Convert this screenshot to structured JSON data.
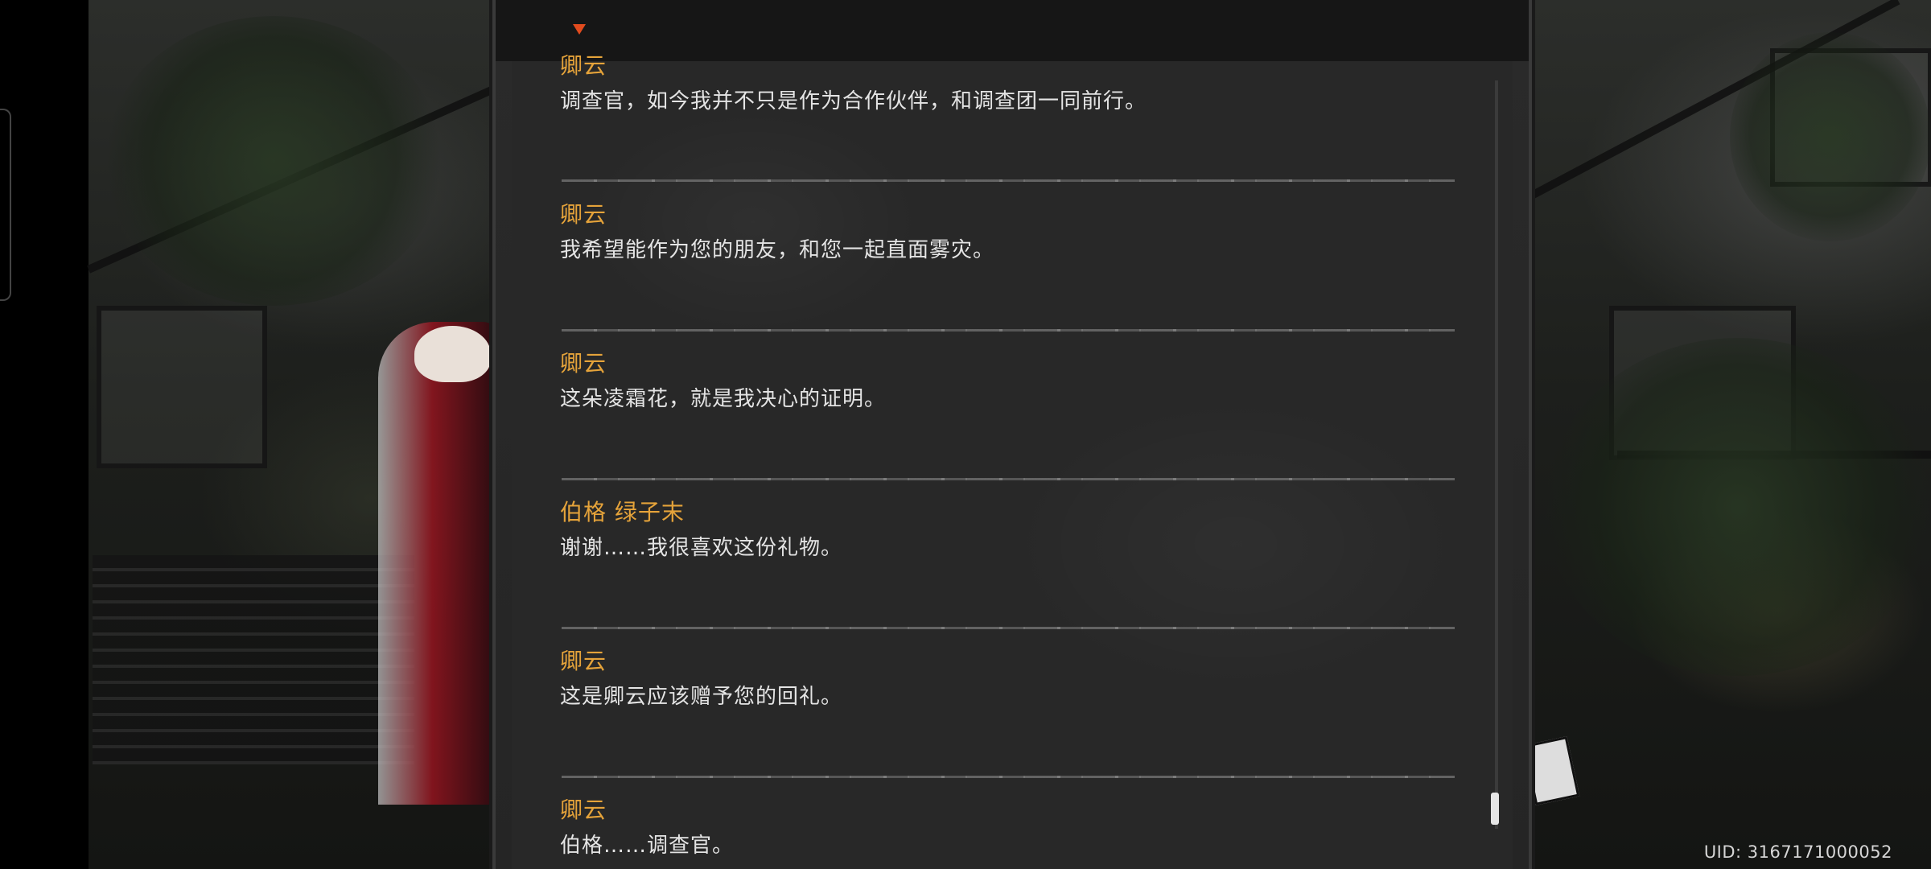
{
  "dialogue_log": {
    "entries": [
      {
        "speaker": "卿云",
        "text": "调查官，如今我并不只是作为合作伙伴，和调查团一同前行。"
      },
      {
        "speaker": "卿云",
        "text": "我希望能作为您的朋友，和您一起直面雾灾。"
      },
      {
        "speaker": "卿云",
        "text": "这朵凌霜花，就是我决心的证明。"
      },
      {
        "speaker": "伯格 绿子末",
        "text": "谢谢……我很喜欢这份礼物。"
      },
      {
        "speaker": "卿云",
        "text": "这是卿云应该赠予您的回礼。"
      },
      {
        "speaker": "卿云",
        "text": "伯格……调查官。"
      }
    ]
  },
  "footer": {
    "uid": "UID:  3167171000052"
  },
  "colors": {
    "speaker": "#e5a33a",
    "text": "#e4e4e4",
    "marker": "#e14b1e"
  }
}
